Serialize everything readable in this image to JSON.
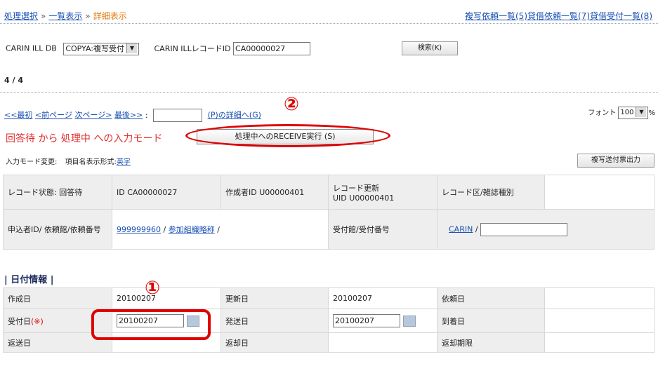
{
  "breadcrumb": {
    "step1": "処理選択",
    "step2": "一覧表示",
    "step3": "詳細表示",
    "sep": "»"
  },
  "toplinks": {
    "copy": "複写依頼一覧(5)",
    "loan": "貸借依頼一覧(7)",
    "loan_recv": "貸借受付一覧(8)"
  },
  "search": {
    "db_label": "CARIN ILL DB",
    "db_value": "COPYA:複写受付",
    "record_label": "CARIN ILLレコードID",
    "record_value": "CA00000027",
    "button": "検索(K)"
  },
  "count": "4 / 4",
  "pager": {
    "first": "<<最初",
    "prev": "<前ページ",
    "next": "次ページ>",
    "last": "最後>>",
    "colon": ":",
    "detail": "(P)の詳細へ(G)"
  },
  "font": {
    "label": "フォント",
    "value": "100",
    "unit": "%"
  },
  "mode_text": "回答待 から 処理中 への入力モード",
  "receive_button": "処理中へのRECEIVE実行 (S)",
  "annotations": {
    "one": "①",
    "two": "②"
  },
  "input_mode": {
    "label": "入力モード変更:",
    "item_label": "項目名表示形式:",
    "item_value": "英字"
  },
  "copy_slip_button": "複写送付票出力",
  "record_info": {
    "status": "レコード状態: 回答待",
    "id": "ID CA00000027",
    "creator": "作成者ID U00000401",
    "update_l1": "レコード更新",
    "update_l2": "UID U00000401",
    "type": "レコード区/雑誌種別",
    "applicant_label": "申込者ID/ 依頼館/依頼番号",
    "applicant_id": "999999960",
    "slash1": "/",
    "applicant_org": "参加組織略称",
    "slash2": "/",
    "recv_label": "受付館/受付番号",
    "recv_lib": "CARIN",
    "slash3": "/"
  },
  "date_section": {
    "title": "| 日付情報 |",
    "created_label": "作成日",
    "created_value": "20100207",
    "updated_label": "更新日",
    "updated_value": "20100207",
    "request_label": "依頼日",
    "received_label": "受付日",
    "received_req": "(※)",
    "received_value": "20100207",
    "sent_label": "発送日",
    "sent_value": "20100207",
    "arrival_label": "到着日",
    "returned_label": "返送日",
    "return_label": "返却日",
    "due_label": "返却期限"
  }
}
